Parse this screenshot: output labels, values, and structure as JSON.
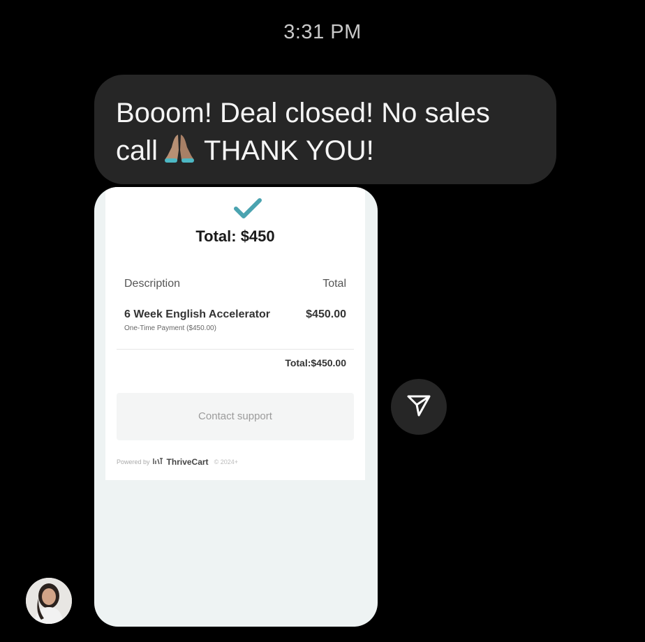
{
  "status": {
    "time": "3:31 PM"
  },
  "message": {
    "text_line1": "Booom! Deal closed! No sales",
    "text_line2_start": "call",
    "text_line2_end": "THANK YOU!",
    "emoji": "folded-hands"
  },
  "receipt": {
    "total_title": "Total: $450",
    "columns": {
      "description": "Description",
      "total": "Total"
    },
    "item": {
      "name": "6 Week English Accelerator",
      "amount": "$450.00",
      "note": "One-Time Payment ($450.00)"
    },
    "grand_total": "Total:$450.00",
    "support_label": "Contact support",
    "footer": {
      "powered_by": "Powered by",
      "brand": "ThriveCart",
      "copyright": "© 2024+"
    },
    "accent_color": "#4aa3b0"
  },
  "icons": {
    "check": "checkmark-icon",
    "share": "paper-plane-icon",
    "avatar": "user-avatar"
  }
}
